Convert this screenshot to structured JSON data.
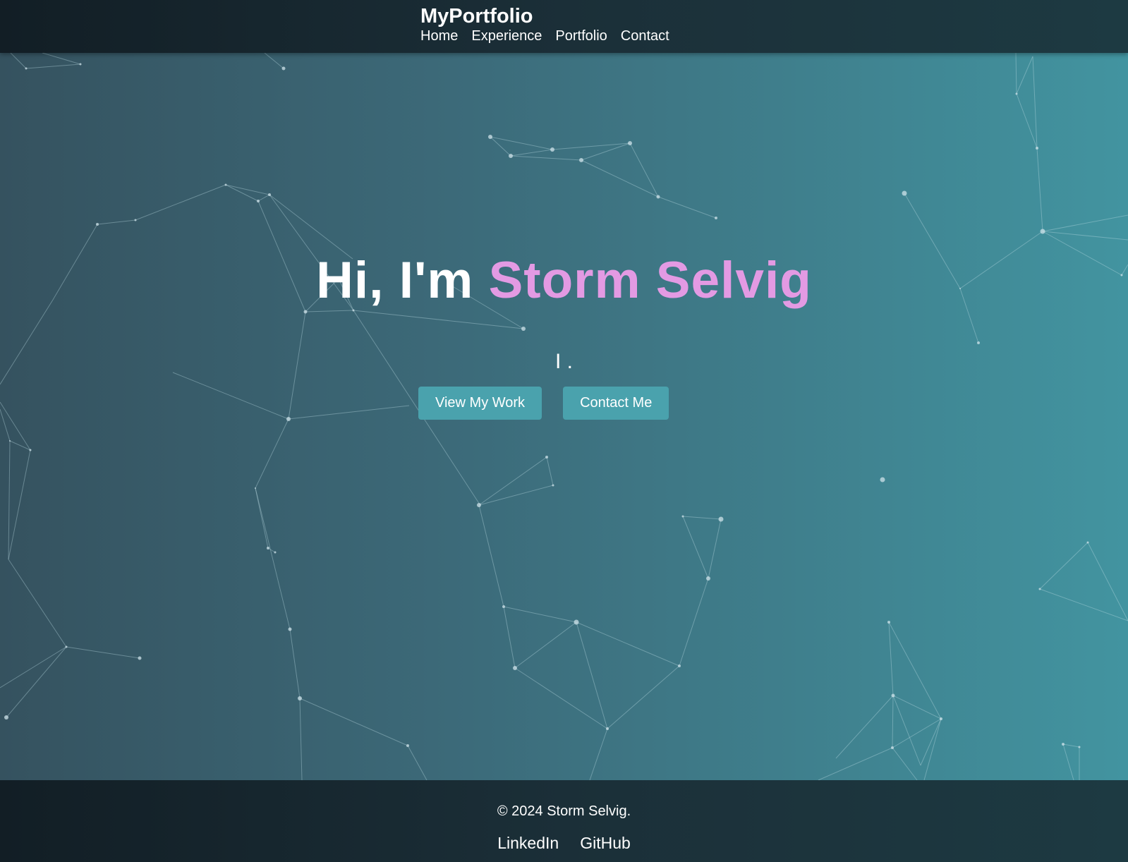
{
  "header": {
    "brand": "MyPortfolio",
    "nav": [
      "Home",
      "Experience",
      "Portfolio",
      "Contact"
    ]
  },
  "hero": {
    "greeting": "Hi, I'm",
    "name": "Storm Selvig",
    "typing_text": "I .",
    "buttons": {
      "view_work": "View My Work",
      "contact": "Contact Me"
    }
  },
  "footer": {
    "copyright": "© 2024 Storm Selvig.",
    "links": [
      "LinkedIn",
      "GitHub"
    ]
  },
  "colors": {
    "accent_name": "#e39ae3",
    "button_bg": "#4aa2ad",
    "header_bg": "#1b2f38"
  }
}
